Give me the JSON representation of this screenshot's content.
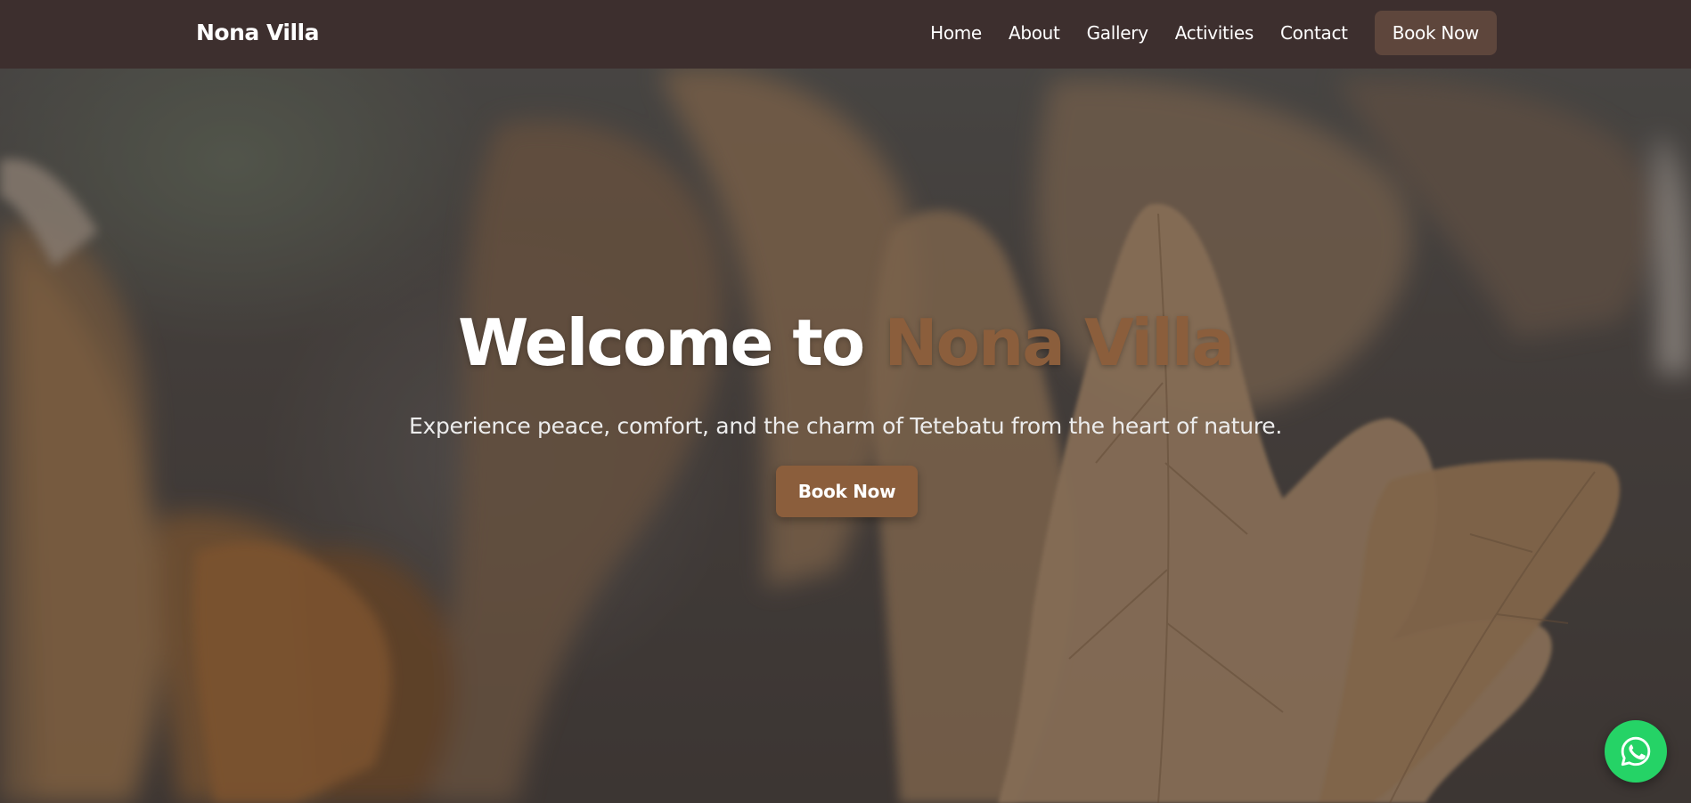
{
  "navbar": {
    "brand": "Nona Villa",
    "links": [
      "Home",
      "About",
      "Gallery",
      "Activities",
      "Contact"
    ],
    "book_label": "Book Now"
  },
  "hero": {
    "title_prefix": "Welcome to ",
    "title_highlight": "Nona Villa",
    "subtitle": "Experience peace, comfort, and the charm of Tetebatu from the heart of nature.",
    "cta_label": "Book Now"
  },
  "floating": {
    "whatsapp_icon": "whatsapp-icon"
  },
  "colors": {
    "navbar_bg": "#3d2f2e",
    "nav_button_bg": "#5e463c",
    "accent": "#8b5e3c",
    "whatsapp": "#25d366"
  }
}
